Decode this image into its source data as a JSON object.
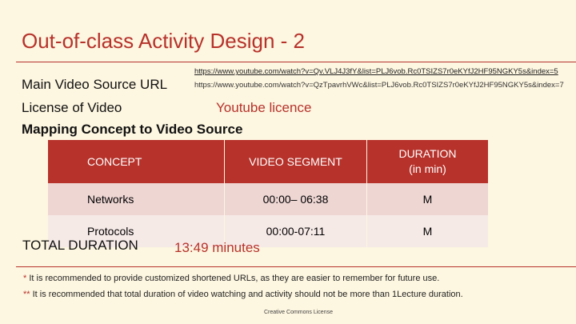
{
  "slide": {
    "title": "Out-of-class Activity Design - 2",
    "url_1": "https://www.youtube.com/watch?v=Qv.VLJ4J3fY&list=PLJ6vob.Rc0TSIZS7r0eKYfJ2HF95NGKY5s&index=5",
    "url_2": "https://www.youtube.com/watch?v=QzTpavrhVWc&list=PLJ6vob.Rc0TSIZS7r0eKYfJ2HF95NGKY5s&index=7",
    "main_video_label": "Main Video Source URL",
    "license_label": "License of Video",
    "license_value": "Youtube licence",
    "mapping_label": "Mapping Concept to Video Source",
    "table": {
      "headers": [
        "CONCEPT",
        "VIDEO SEGMENT",
        "DURATION",
        "(in min)"
      ],
      "rows": [
        {
          "concept": "Networks",
          "segment": "00:00– 06:38",
          "duration": "M"
        },
        {
          "concept": "Protocols",
          "segment": "00:00-07:11",
          "duration": "M"
        }
      ]
    },
    "total_label": "TOTAL DURATION",
    "total_value": "13:49 minutes",
    "note_1_star": "*",
    "note_1": " It is recommended to provide customized shortened URLs, as they are easier to remember for future use.",
    "note_2_star": "**",
    "note_2": " It is recommended that total duration of video watching and activity should not be more than 1Lecture duration.",
    "footer": "Creative Commons License"
  },
  "colors": {
    "accent": "#b6322b",
    "background": "#fdf6e0",
    "row_1": "#eed6d3",
    "row_2": "#f6eae7"
  }
}
